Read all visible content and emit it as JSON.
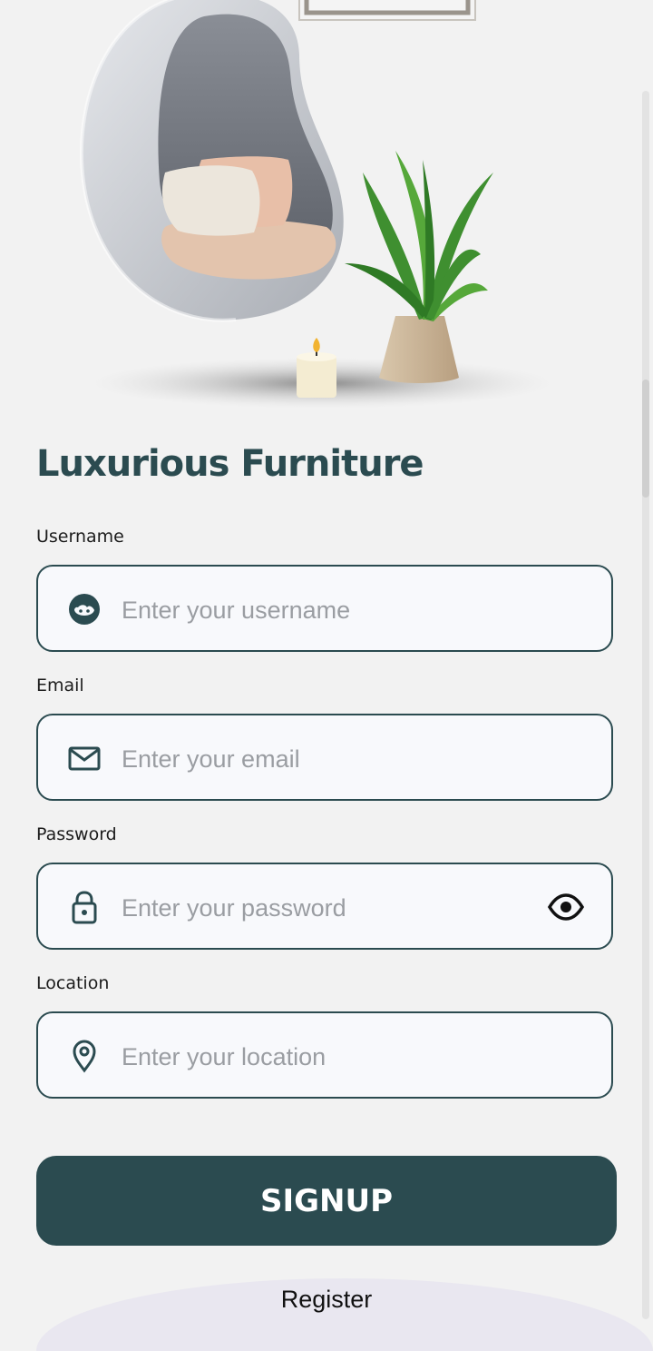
{
  "app": {
    "title": "Luxurious Furniture"
  },
  "form": {
    "username": {
      "label": "Username",
      "placeholder": "Enter your username",
      "value": ""
    },
    "email": {
      "label": "Email",
      "placeholder": "Enter your email",
      "value": ""
    },
    "password": {
      "label": "Password",
      "placeholder": "Enter your password",
      "value": ""
    },
    "location": {
      "label": "Location",
      "placeholder": "Enter your location",
      "value": ""
    }
  },
  "actions": {
    "signup_label": "SIGNUP",
    "register_label": "Register"
  },
  "icons": {
    "username": "user-face-icon",
    "email": "mail-icon",
    "password": "lock-icon",
    "password_toggle": "eye-icon",
    "location": "location-pin-icon"
  },
  "colors": {
    "primary": "#2b4b50",
    "background": "#f2f2f2",
    "field_background": "#f8f9fc",
    "placeholder": "#9a9da2"
  }
}
